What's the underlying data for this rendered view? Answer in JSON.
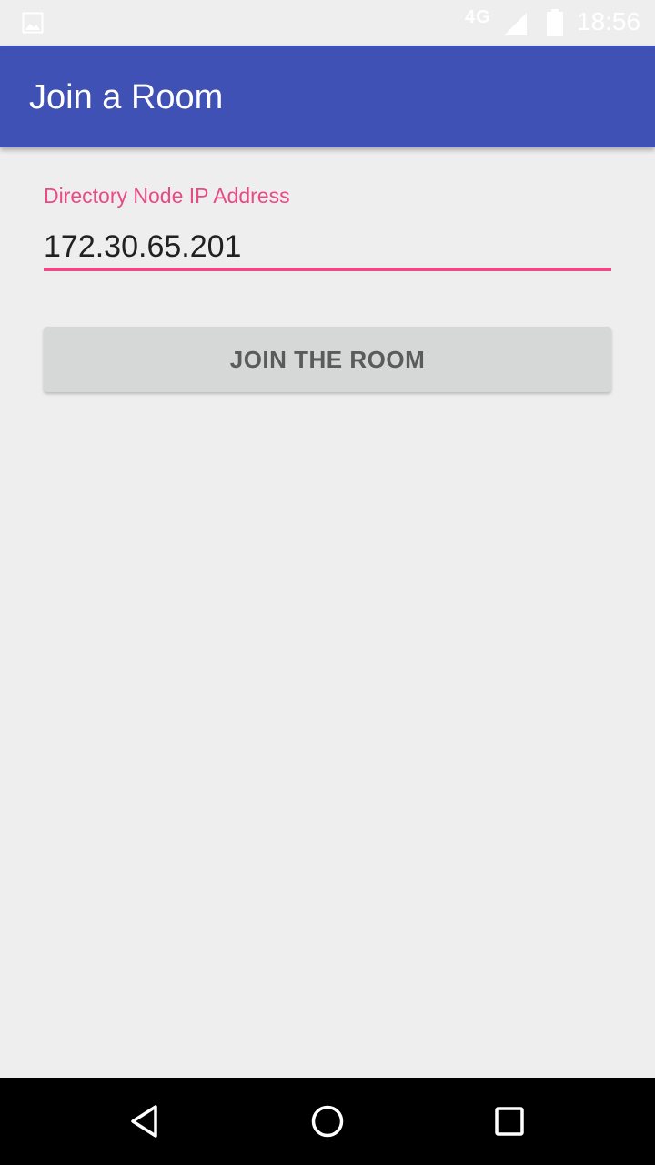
{
  "status_bar": {
    "network": "4G",
    "time": "18:56",
    "icons": [
      "picture-icon",
      "signal-icon",
      "battery-icon"
    ]
  },
  "app_bar": {
    "title": "Join a Room",
    "color": "#3f51b5"
  },
  "form": {
    "ip_label": "Directory Node IP Address",
    "ip_value": "172.30.65.201",
    "accent_color": "#ea4a86",
    "join_button_label": "JOIN THE ROOM"
  },
  "nav_bar": {
    "icons": [
      "back-icon",
      "home-icon",
      "recents-icon"
    ]
  }
}
